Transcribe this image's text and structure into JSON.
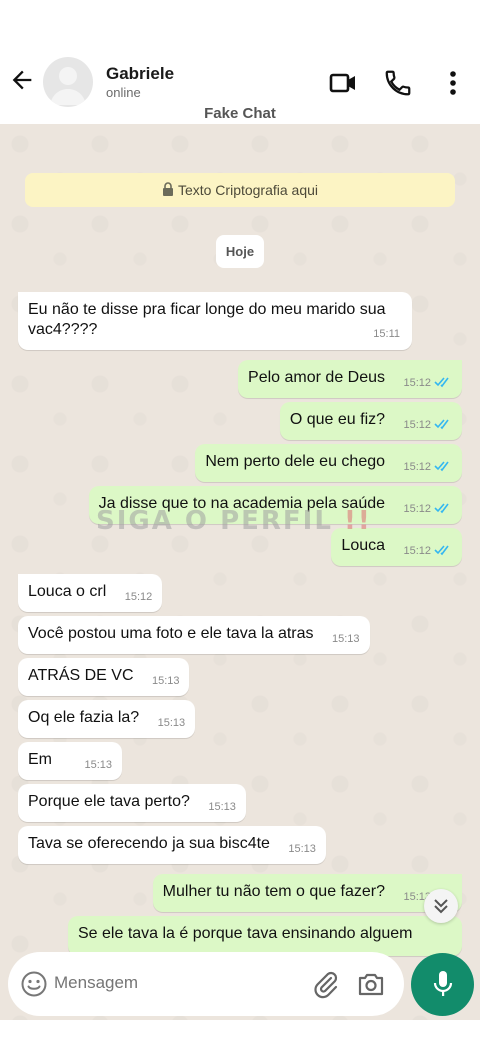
{
  "header": {
    "contact_name": "Gabriele",
    "contact_status": "online",
    "subtitle": "Fake Chat"
  },
  "chat": {
    "encryption_notice": "Texto Criptografia aqui",
    "date_chip": "Hoje",
    "watermark": "SIGA O PERFIL",
    "watermark_suffix": "!!",
    "messages": [
      {
        "dir": "in",
        "text": "Eu não te disse pra ficar longe do meu marido sua vac4????",
        "time": "15:11"
      },
      {
        "dir": "out",
        "text": "Pelo amor de Deus",
        "time": "15:12"
      },
      {
        "dir": "out",
        "text": "O que eu fiz?",
        "time": "15:12"
      },
      {
        "dir": "out",
        "text": "Nem perto dele eu chego",
        "time": "15:12"
      },
      {
        "dir": "out",
        "text": "Ja disse que to na academia pela saúde",
        "time": "15:12"
      },
      {
        "dir": "out",
        "text": "Louca",
        "time": "15:12"
      },
      {
        "dir": "in",
        "text": "Louca o crl",
        "time": "15:12"
      },
      {
        "dir": "in",
        "text": "Você postou uma foto e ele tava la atras",
        "time": "15:13"
      },
      {
        "dir": "in",
        "text": "ATRÁS DE VC",
        "time": "15:13"
      },
      {
        "dir": "in",
        "text": "Oq ele fazia la?",
        "time": "15:13"
      },
      {
        "dir": "in",
        "text": "Em",
        "time": "15:13"
      },
      {
        "dir": "in",
        "text": "Porque ele tava perto?",
        "time": "15:13"
      },
      {
        "dir": "in",
        "text": "Tava se oferecendo ja sua bisc4te",
        "time": "15:13"
      },
      {
        "dir": "out",
        "text": "Mulher tu não tem o que fazer?",
        "time": "15:13"
      },
      {
        "dir": "out",
        "text": "Se ele tava la é porque tava ensinando alguem",
        "time": ""
      }
    ]
  },
  "composer": {
    "placeholder": "Mensagem"
  },
  "colors": {
    "outgoing_bubble": "#dcf8c6",
    "incoming_bubble": "#ffffff",
    "accent": "#128c6b",
    "read_ticks": "#34b7f1",
    "chat_background": "#ece5dd"
  },
  "icons": [
    "back-arrow-icon",
    "video-call-icon",
    "phone-icon",
    "more-vert-icon",
    "lock-icon",
    "double-check-icon",
    "chevron-double-down-icon",
    "emoji-icon",
    "attach-icon",
    "camera-icon",
    "mic-icon"
  ]
}
